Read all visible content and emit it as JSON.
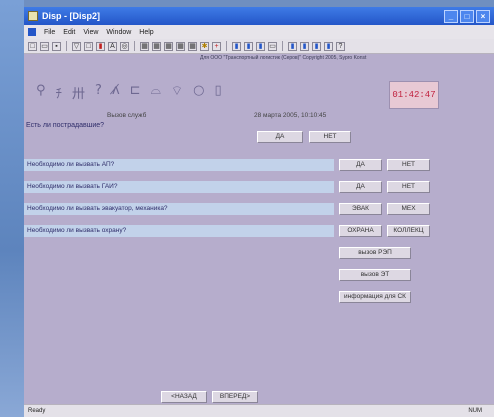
{
  "window": {
    "title": "Disp - [Disp2]",
    "min": "_",
    "max": "□",
    "close": "×"
  },
  "menu": {
    "file": "File",
    "edit": "Edit",
    "view": "View",
    "window": "Window",
    "help": "Help"
  },
  "copyright": "Для ООО \"Транспортный логистик (Серов)\"  Copyright 2005, Sypro Konst",
  "time": "01:42:47",
  "call": {
    "label": "Вызов служб",
    "datetime": "28 марта 2005, 10:10:45"
  },
  "question0": {
    "text": "Есть ли пострадавшие?",
    "yes": "ДА",
    "no": "НЕТ"
  },
  "rows": [
    {
      "text": "Необходимо ли вызвать АП?",
      "b1": "ДА",
      "b2": "НЕТ"
    },
    {
      "text": "Необходимо ли вызвать ГАИ?",
      "b1": "ДА",
      "b2": "НЕТ"
    },
    {
      "text": "Необходимо ли вызвать эвакуатор, механика?",
      "b1": "ЭВАК",
      "b2": "МЕХ"
    },
    {
      "text": "Необходимо ли вызвать охрану?",
      "b1": "ОХРАНА",
      "b2": "КОЛЛЕКЦ"
    }
  ],
  "extra_buttons": [
    "вызов РЭП",
    "вызов ЭТ",
    "информация для СК"
  ],
  "nav": {
    "back": "<НАЗАД",
    "forward": "ВПЕРЕД>"
  },
  "status": {
    "ready": "Ready",
    "num": "NUM"
  }
}
